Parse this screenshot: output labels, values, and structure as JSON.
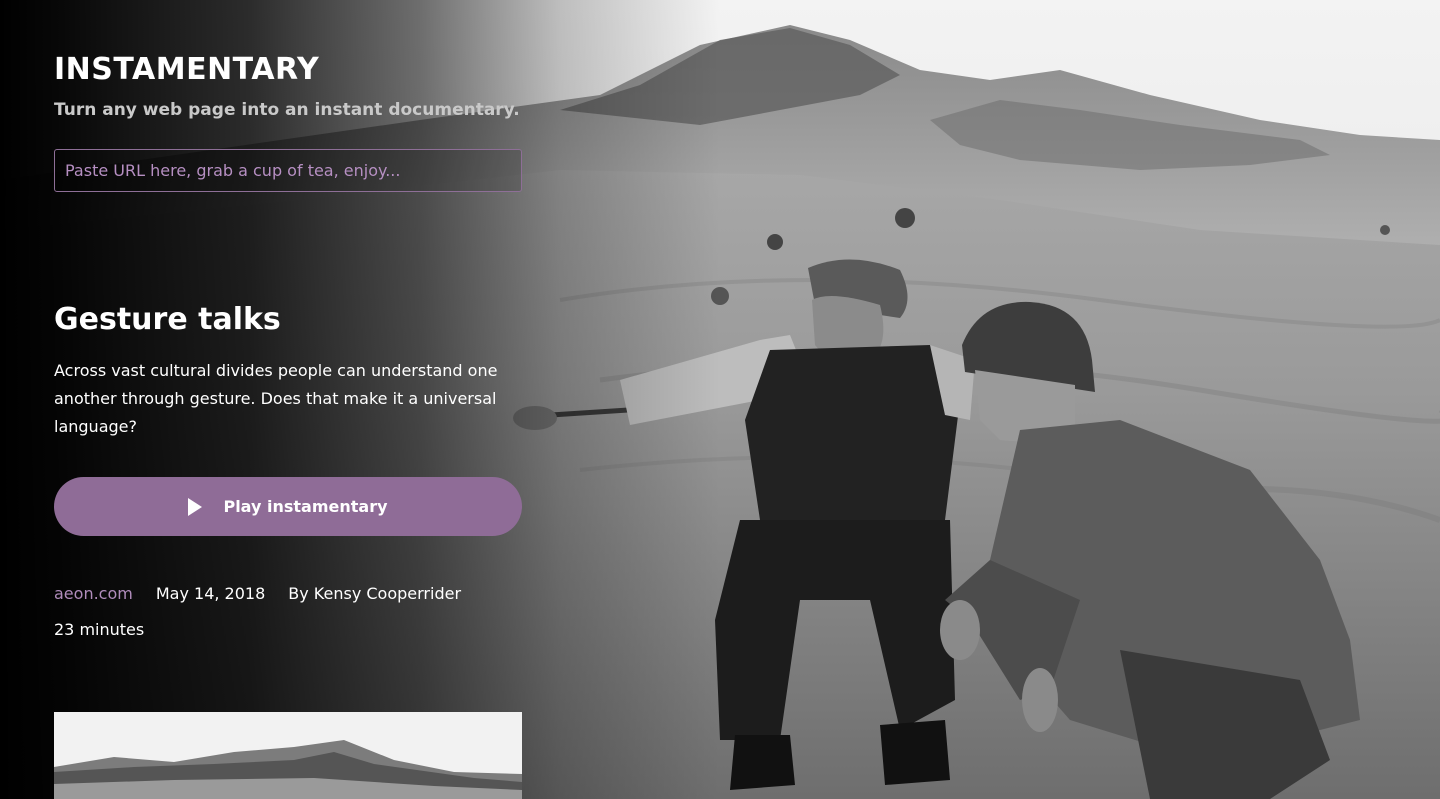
{
  "app": {
    "title": "INSTAMENTARY",
    "tagline": "Turn any web page into an instant documentary."
  },
  "search": {
    "placeholder": "Paste URL here, grab a cup of tea, enjoy...",
    "value": ""
  },
  "article": {
    "title": "Gesture talks",
    "description": "Across vast cultural divides people can understand one another through gesture. Does that make it a universal language?",
    "source": "aeon.com",
    "date": "May 14, 2018",
    "author": "By Kensy Cooperrider",
    "duration": "23 minutes"
  },
  "play_button": {
    "label": "Play instamentary",
    "icon": "play-icon"
  },
  "colors": {
    "accent": "#8f6c97",
    "link": "#b08cbb",
    "placeholder": "#b68fc2",
    "background": "#000000",
    "text": "#ffffff"
  }
}
